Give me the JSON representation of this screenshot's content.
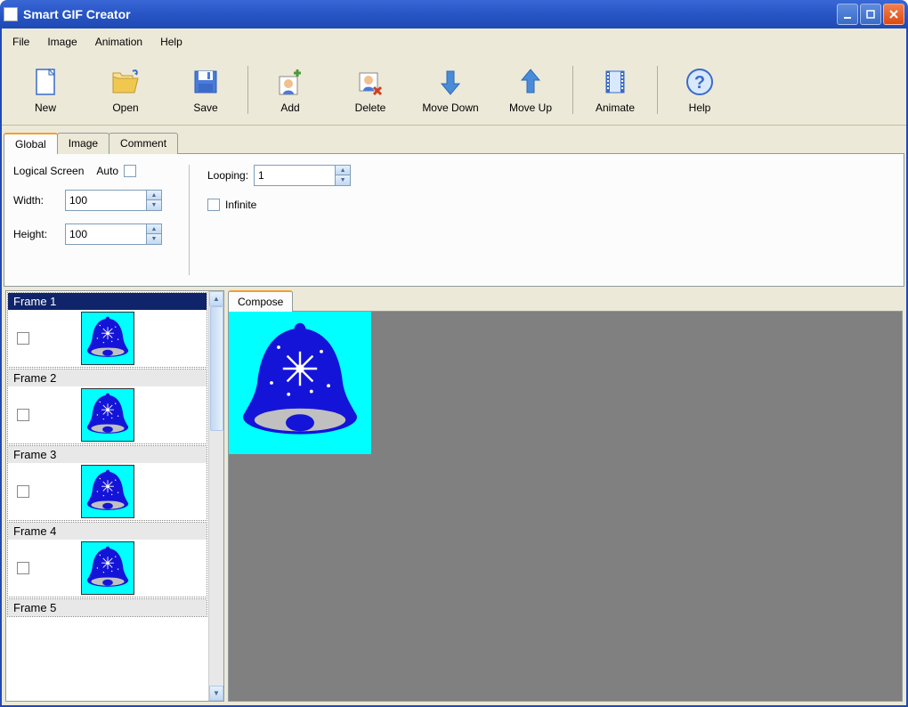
{
  "titlebar": {
    "title": "Smart GIF Creator"
  },
  "menu": {
    "file": "File",
    "image": "Image",
    "animation": "Animation",
    "help": "Help"
  },
  "toolbar": {
    "new": "New",
    "open": "Open",
    "save": "Save",
    "add": "Add",
    "delete": "Delete",
    "move_down": "Move Down",
    "move_up": "Move Up",
    "animate": "Animate",
    "help": "Help"
  },
  "tabs": {
    "global": "Global",
    "image": "Image",
    "comment": "Comment"
  },
  "global_panel": {
    "logical_screen": "Logical Screen",
    "auto": "Auto",
    "width_label": "Width:",
    "width_value": "100",
    "height_label": "Height:",
    "height_value": "100",
    "looping_label": "Looping:",
    "looping_value": "1",
    "infinite": "Infinite"
  },
  "frames": {
    "items": [
      {
        "label": "Frame 1"
      },
      {
        "label": "Frame 2"
      },
      {
        "label": "Frame 3"
      },
      {
        "label": "Frame 4"
      },
      {
        "label": "Frame 5"
      }
    ]
  },
  "compose": {
    "tab": "Compose"
  }
}
